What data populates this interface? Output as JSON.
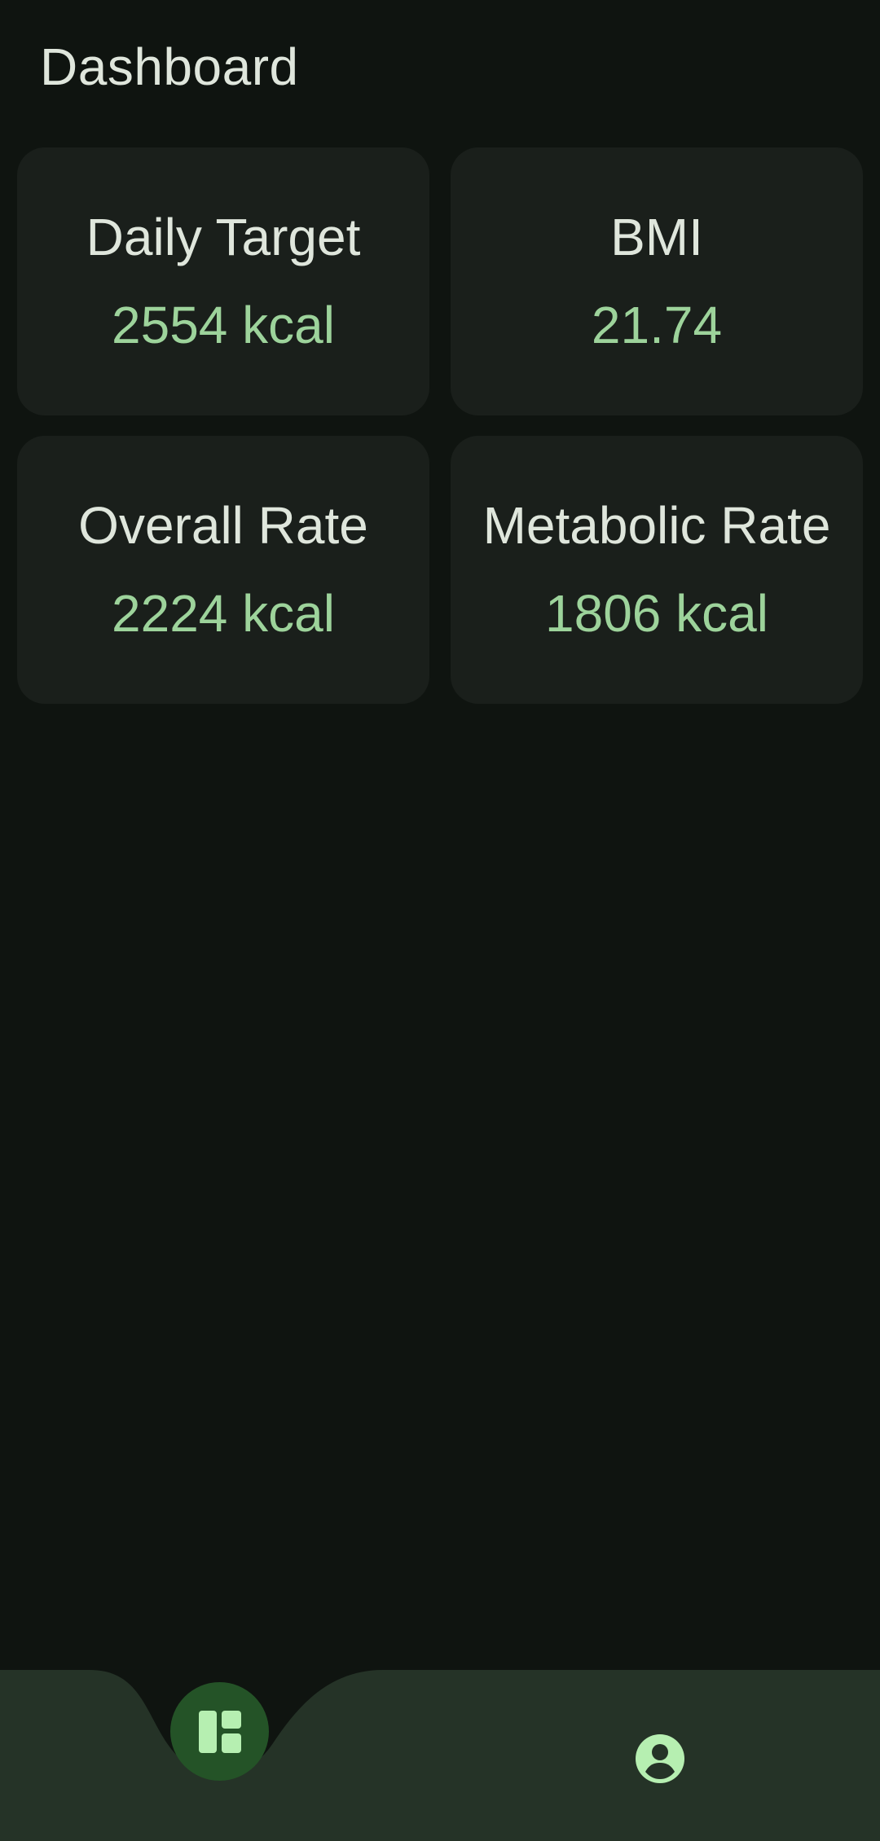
{
  "header": {
    "title": "Dashboard"
  },
  "cards": [
    {
      "label": "Daily Target",
      "value": "2554 kcal"
    },
    {
      "label": "BMI",
      "value": "21.74"
    },
    {
      "label": "Overall Rate",
      "value": "2224 kcal"
    },
    {
      "label": "Metabolic Rate",
      "value": "1806 kcal"
    }
  ],
  "bottom_nav": {
    "items": [
      {
        "icon": "dashboard-icon",
        "selected": true
      },
      {
        "icon": "account-circle-icon",
        "selected": false
      }
    ]
  },
  "colors": {
    "background": "#0f1410",
    "card": "#1a1f1b",
    "text": "#dfe6dc",
    "accent_value": "#9dd39b",
    "nav_bar": "#253327",
    "fab": "#245327",
    "icon": "#b6efb1"
  }
}
